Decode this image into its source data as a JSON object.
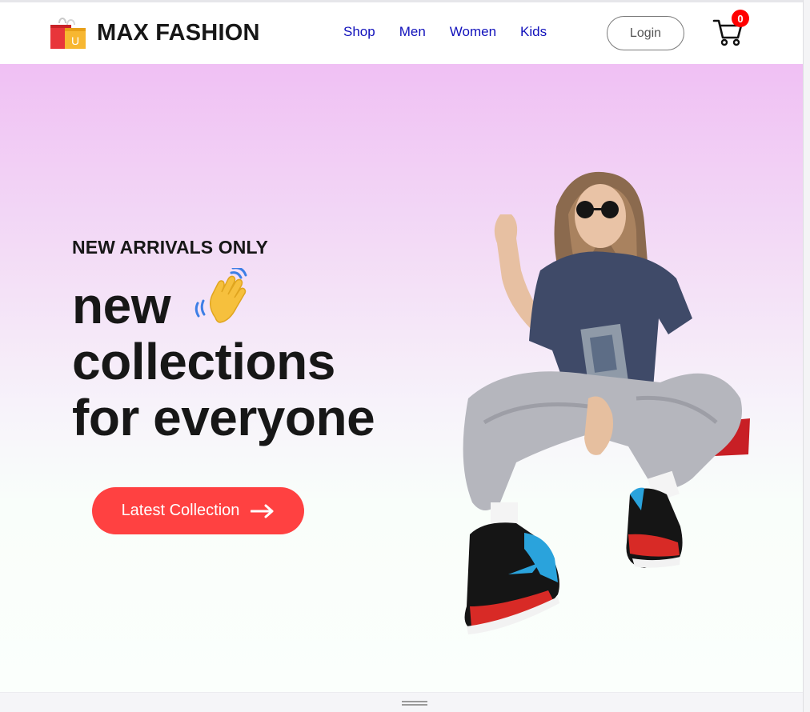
{
  "brand": {
    "name": "MAX FASHION",
    "logo_icon": "shopping-bag-icon",
    "logo_letter": "U"
  },
  "nav": {
    "links": [
      "Shop",
      "Men",
      "Women",
      "Kids"
    ],
    "link_color": "#1111bb",
    "login_label": "Login",
    "cart_icon": "cart-icon",
    "cart_count": "0",
    "badge_color": "#ff0000"
  },
  "hero": {
    "tagline": "NEW ARRIVALS ONLY",
    "headline_lines": [
      "new",
      "collections",
      "for everyone"
    ],
    "wave_icon": "waving-hand-icon",
    "cta_label": "Latest Collection",
    "cta_icon": "arrow-right-icon",
    "cta_color": "#ff4141",
    "gradient_top": "#f0c0f4",
    "gradient_bottom": "#fbfffc",
    "image": "hero-model-image"
  }
}
